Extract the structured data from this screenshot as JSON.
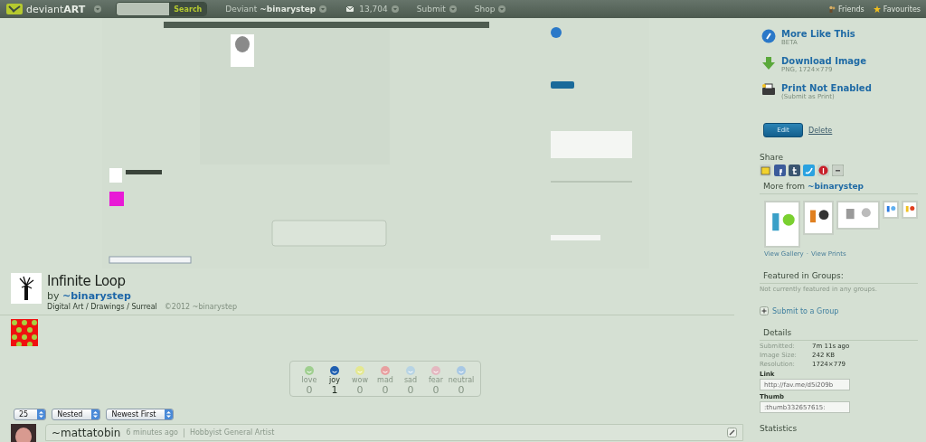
{
  "top_bar": {
    "logo_text": "deviant",
    "logo_bold": "ART",
    "search": {
      "button": "Search"
    },
    "nav": [
      {
        "label": "Deviant",
        "strong": "~binarystep"
      },
      {
        "label": "13,704"
      },
      {
        "label": "Submit"
      },
      {
        "label": "Shop"
      }
    ],
    "right": [
      "Friends",
      "Favourites"
    ]
  },
  "page": {
    "image": {
      "kind": "picture"
    },
    "deviation": {
      "title": "Infinite Loop",
      "by": "by",
      "artist": "~binarystep",
      "category": "Digital Art / Drawings / Surreal",
      "copyright": "©2012 ~binarystep"
    },
    "reactions": [
      {
        "label": "love",
        "count": "0",
        "selected": false
      },
      {
        "label": "joy",
        "count": "1",
        "selected": true
      },
      {
        "label": "wow",
        "count": "0",
        "selected": false
      },
      {
        "label": "mad",
        "count": "0",
        "selected": false
      },
      {
        "label": "sad",
        "count": "0",
        "selected": false
      },
      {
        "label": "fear",
        "count": "0",
        "selected": false
      },
      {
        "label": "neutral",
        "count": "0",
        "selected": false
      }
    ],
    "comment_controls": [
      "25",
      "Nested",
      "Newest First"
    ],
    "comment": {
      "username": "~mattatobin",
      "time": "6 minutes ago",
      "role": "Hobbyist General Artist"
    },
    "sidebar": {
      "actions": [
        {
          "kind": "more",
          "title": "More Like This",
          "sub": "BETA"
        },
        {
          "kind": "download",
          "title": "Download Image",
          "sub": "PNG, 1724×779"
        },
        {
          "kind": "print",
          "title": "Print Not Enabled",
          "sub": "(Submit as Print)"
        }
      ],
      "edit": "Edit",
      "delete": "Delete",
      "share": "Share",
      "more_from": "More from",
      "more_from_artist": "~binarystep",
      "gallery_links": [
        "View Gallery",
        "·",
        "View Prints"
      ],
      "groups_title": "Featured in Groups:",
      "groups_text": "Not currently featured in any groups.",
      "submit_group": "Submit to a Group",
      "details_title": "Details",
      "details": [
        {
          "label": "Submitted:",
          "value": "7m 11s ago"
        },
        {
          "label": "Image Size:",
          "value": "242 KB"
        },
        {
          "label": "Resolution:",
          "value": "1724×779"
        }
      ],
      "link_label": "Link",
      "link_value": "http://fav.me/d5i209b",
      "thumb_label": "Thumb",
      "thumb_value": ":thumb332657615:",
      "statistics": "Statistics"
    }
  }
}
